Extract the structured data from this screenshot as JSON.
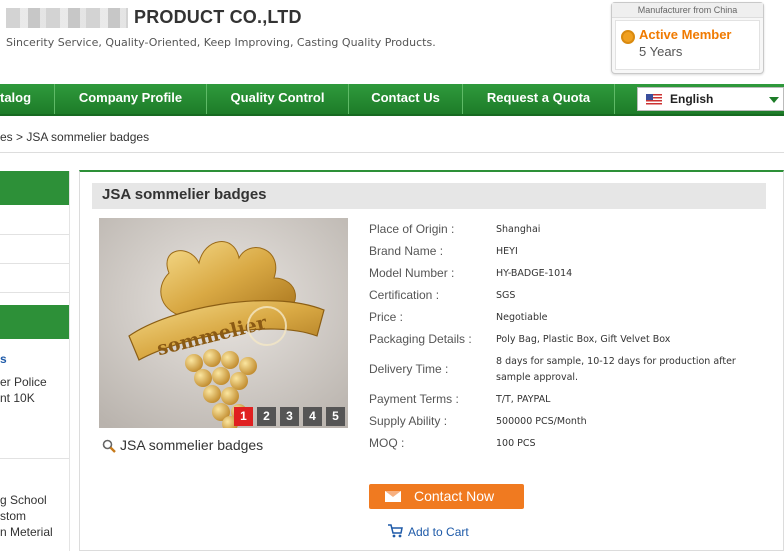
{
  "header": {
    "company_name": "PRODUCT CO.,LTD",
    "slogan": "Sincerity Service, Quality-Oriented, Keep Improving, Casting Quality Products.",
    "badge_caption": "Manufacturer from China",
    "badge_title": "Active Member",
    "badge_years": "5 Years"
  },
  "nav": {
    "items": [
      "talog",
      "Company Profile",
      "Quality Control",
      "Contact Us",
      "Request a Quota"
    ],
    "language": "English"
  },
  "breadcrumb": "es > JSA sommelier badges",
  "sidebar": {
    "link": "s",
    "lines": [
      "er Police",
      "nt 10K",
      "g School",
      "stom",
      "n Meterial"
    ]
  },
  "product": {
    "title": "JSA sommelier badges",
    "caption": "JSA sommelier badges",
    "pages": [
      "1",
      "2",
      "3",
      "4",
      "5"
    ],
    "active_page": "1",
    "specs": [
      {
        "label": "Place of Origin :",
        "value": "Shanghai"
      },
      {
        "label": "Brand Name :",
        "value": "HEYI"
      },
      {
        "label": "Model Number :",
        "value": "HY-BADGE-1014"
      },
      {
        "label": "Certification :",
        "value": "SGS"
      },
      {
        "label": "Price :",
        "value": "Negotiable"
      },
      {
        "label": "Packaging Details :",
        "value": "Poly Bag, Plastic Box, Gift Velvet Box"
      },
      {
        "label": "Delivery Time :",
        "value": "8 days for sample, 10-12 days for production after sample approval."
      },
      {
        "label": "Payment Terms :",
        "value": "T/T, PAYPAL"
      },
      {
        "label": "Supply Ability :",
        "value": "500000 PCS/Month"
      },
      {
        "label": "MOQ :",
        "value": "100 PCS"
      }
    ],
    "contact_label": "Contact Now",
    "cart_label": "Add to Cart"
  },
  "colors": {
    "nav_green": "#2d9038",
    "accent_orange": "#f07a20",
    "link_blue": "#1e5aa8",
    "active_page_red": "#e02020"
  }
}
